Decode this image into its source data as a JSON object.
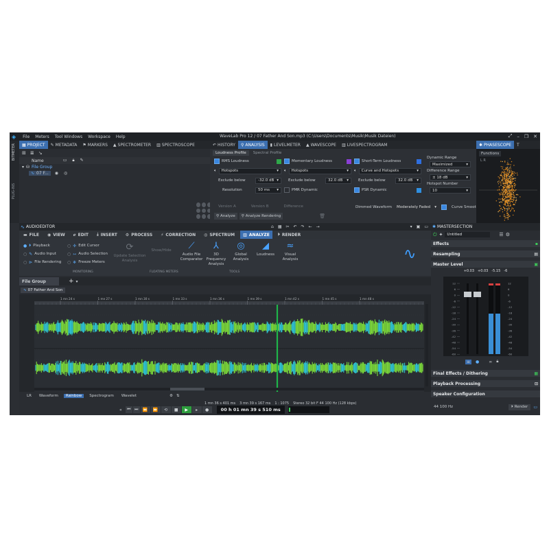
{
  "window": {
    "title": "WaveLab Pro 12 / 07 Father And Son.mp3 (C:\\Users\\Documents\\Musik\\Musik Dateien)",
    "menu": [
      "File",
      "Meters",
      "Tool Windows",
      "Workspace",
      "Help"
    ]
  },
  "left_panel": {
    "side_labels": [
      "BITMETER",
      "PLUG-INS"
    ],
    "tabs": [
      {
        "label": "PROJECT",
        "active": true
      },
      {
        "label": "METADATA"
      },
      {
        "label": "MARKERS"
      },
      {
        "label": "SPECTROMETER"
      },
      {
        "label": "SPECTROSCOPE"
      }
    ],
    "tree_header": "Name",
    "tree_items": [
      "File Group",
      "07 F..."
    ]
  },
  "analysis_panel": {
    "tabs": [
      {
        "label": "HISTORY"
      },
      {
        "label": "ANALYSIS",
        "active": true
      },
      {
        "label": "LEVELMETER"
      },
      {
        "label": "WAVESCOPE"
      },
      {
        "label": "LIVESPECTROGRAM"
      }
    ],
    "subtabs": [
      "Loudness Profile",
      "Spectral Profile"
    ],
    "columns": [
      {
        "checkbox": "RMS Loudness",
        "mode": "Hotspots",
        "exclude_label": "Exclude below",
        "exclude_value": "-32.0 dB",
        "resolution_label": "Resolution",
        "resolution_value": "50 ms",
        "color": "#2fa84a"
      },
      {
        "checkbox": "Momentary Loudness",
        "mode": "Hotspots",
        "exclude_label": "Exclude below",
        "exclude_value": "32.0 dB",
        "extra": "PMR Dynamic",
        "color": "#8a3fd6"
      },
      {
        "checkbox": "Short-Term Loudness",
        "mode": "Curve and Hotspots",
        "exclude_label": "Exclude below",
        "exclude_value": "32.0 dB",
        "extra": "PSR Dynamic",
        "color": "#2f6fe0"
      }
    ],
    "dynamic_range_label": "Dynamic Range",
    "dynamic_range_value": "Maximized",
    "difference_range_label": "Difference Range",
    "difference_range_value": "± 18 dB",
    "hotspot_number_label": "Hotspot Number",
    "hotspot_number_value": "10",
    "versions": [
      "Version A",
      "Version B",
      "Difference"
    ],
    "analyze_label": "Analyze",
    "analyze_rendering_label": "Analyze Rendering",
    "dimmed_waveform_label": "Dimmed Waveform",
    "dimmed_waveform_value": "Moderately Faded",
    "curve_smoothing_label": "Curve Smoothing"
  },
  "phasescope": {
    "tabs": [
      "PHASESCOPE",
      "T"
    ],
    "functions_label": "Functions",
    "lr_label": "L R"
  },
  "audio_editor": {
    "title": "AUDIOEDITOR",
    "ribbon_tabs": [
      {
        "label": "FILE"
      },
      {
        "label": "VIEW"
      },
      {
        "label": "EDIT"
      },
      {
        "label": "INSERT"
      },
      {
        "label": "PROCESS"
      },
      {
        "label": "CORRECTION"
      },
      {
        "label": "SPECTRUM"
      },
      {
        "label": "ANALYZE",
        "active": true
      },
      {
        "label": "RENDER"
      }
    ],
    "monitoring_items": [
      "Playback",
      "Audio Input",
      "File Rendering"
    ],
    "cursor_items": [
      "Edit Cursor",
      "Audio Selection",
      "Freeze Meters"
    ],
    "update_selection_label": "Update Selection Analysis",
    "show_hide_label": "Show/Hide",
    "tools": [
      "Audio File Comparator",
      "3D Frequency Analysis",
      "Global Analysis",
      "Loudness",
      "Visual Analysis"
    ],
    "groups": [
      "MONITORING",
      "FLOATING METERS",
      "TOOLS"
    ],
    "file_group_tab": "File Group",
    "file_tab": "07 Father And Son",
    "time_ticks": [
      "1 mn 24 s",
      "1 mn 27 s",
      "1 mn 30 s",
      "1 mn 33 s",
      "1 mn 36 s",
      "1 mn 39 s",
      "1 mn 42 s",
      "1 mn 45 s",
      "1 mn 48 s"
    ],
    "view_modes": [
      "LR",
      "Waveform",
      "Rainbow",
      "Spectrogram",
      "Wavelet"
    ],
    "active_view_mode": "Rainbow",
    "selection_start": "1 mn 36 s 401 ms",
    "selection_length": "3 mn 39 s 167 ms",
    "zoom": "1 : 1075",
    "format": "Stereo 32 bit F 44 100 Hz (128 kbps)"
  },
  "transport": {
    "time": "00 h 01 mn 39 s 510 ms"
  },
  "master_section": {
    "title": "MASTERSECTION",
    "preset": "Untitled",
    "effects_label": "Effects",
    "resampling_label": "Resampling",
    "master_level_label": "Master Level",
    "level_readout": [
      "+0.03",
      "+0.03",
      "-5.15",
      "-6"
    ],
    "scale": [
      "12",
      "6",
      "0",
      "-6",
      "-12",
      "-18",
      "-24",
      "-30",
      "-36",
      "-42",
      "-48",
      "-54",
      "-60"
    ],
    "final_effects_label": "Final Effects / Dithering",
    "playback_processing_label": "Playback Processing",
    "speaker_config_label": "Speaker Configuration",
    "sample_rate": "44 100 Hz",
    "render_label": "Render"
  },
  "colors": {
    "accent": "#3c6fb0",
    "wave_green": "#7cdc3a",
    "wave_cyan": "#2fc7d6",
    "playhead": "#1fb54a",
    "play_button": "#2e9e3e"
  }
}
